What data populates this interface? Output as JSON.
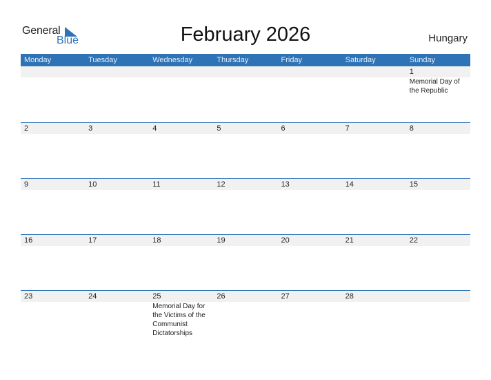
{
  "logo": {
    "line1": "General",
    "line2": "Blue",
    "accent": "#2f72b7"
  },
  "title": "February 2026",
  "country": "Hungary",
  "colors": {
    "header_bg": "#2e73b6",
    "band_bg": "#f1f1f1"
  },
  "weekdays": [
    "Monday",
    "Tuesday",
    "Wednesday",
    "Thursday",
    "Friday",
    "Saturday",
    "Sunday"
  ],
  "weeks": [
    {
      "days": [
        {
          "num": "",
          "holiday": ""
        },
        {
          "num": "",
          "holiday": ""
        },
        {
          "num": "",
          "holiday": ""
        },
        {
          "num": "",
          "holiday": ""
        },
        {
          "num": "",
          "holiday": ""
        },
        {
          "num": "",
          "holiday": ""
        },
        {
          "num": "1",
          "holiday": "Memorial Day of the Republic"
        }
      ]
    },
    {
      "days": [
        {
          "num": "2",
          "holiday": ""
        },
        {
          "num": "3",
          "holiday": ""
        },
        {
          "num": "4",
          "holiday": ""
        },
        {
          "num": "5",
          "holiday": ""
        },
        {
          "num": "6",
          "holiday": ""
        },
        {
          "num": "7",
          "holiday": ""
        },
        {
          "num": "8",
          "holiday": ""
        }
      ]
    },
    {
      "days": [
        {
          "num": "9",
          "holiday": ""
        },
        {
          "num": "10",
          "holiday": ""
        },
        {
          "num": "11",
          "holiday": ""
        },
        {
          "num": "12",
          "holiday": ""
        },
        {
          "num": "13",
          "holiday": ""
        },
        {
          "num": "14",
          "holiday": ""
        },
        {
          "num": "15",
          "holiday": ""
        }
      ]
    },
    {
      "days": [
        {
          "num": "16",
          "holiday": ""
        },
        {
          "num": "17",
          "holiday": ""
        },
        {
          "num": "18",
          "holiday": ""
        },
        {
          "num": "19",
          "holiday": ""
        },
        {
          "num": "20",
          "holiday": ""
        },
        {
          "num": "21",
          "holiday": ""
        },
        {
          "num": "22",
          "holiday": ""
        }
      ]
    },
    {
      "days": [
        {
          "num": "23",
          "holiday": ""
        },
        {
          "num": "24",
          "holiday": ""
        },
        {
          "num": "25",
          "holiday": "Memorial Day for the Victims of the Communist Dictatorships"
        },
        {
          "num": "26",
          "holiday": ""
        },
        {
          "num": "27",
          "holiday": ""
        },
        {
          "num": "28",
          "holiday": ""
        },
        {
          "num": "",
          "holiday": ""
        }
      ]
    }
  ]
}
